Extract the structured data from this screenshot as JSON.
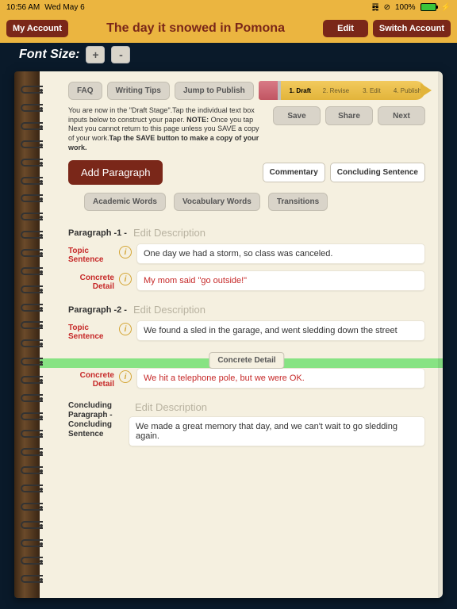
{
  "status": {
    "time": "10:56 AM",
    "date": "Wed May 6",
    "battery": "100%"
  },
  "header": {
    "my_account": "My Account",
    "title": "The day it snowed in Pomona",
    "edit": "Edit",
    "switch": "Switch Account"
  },
  "font": {
    "label": "Font Size:",
    "plus": "+",
    "minus": "-"
  },
  "pills": {
    "faq": "FAQ",
    "tips": "Writing Tips",
    "jump": "Jump to Publish"
  },
  "stages": {
    "s1": "1. Draft",
    "s2": "2. Revise",
    "s3": "3. Edit",
    "s4": "4. Publish"
  },
  "help": {
    "text1": "You are now in the \"Draft Stage\".Tap the individual text box inputs below to construct your paper. ",
    "note": "NOTE:",
    "text2": " Once you tap Next you cannot return to this page unless you SAVE a copy of your work.",
    "bold": "Tap the SAVE button to make a copy of your work."
  },
  "actions": {
    "save": "Save",
    "share": "Share",
    "next": "Next"
  },
  "add": {
    "label": "Add Paragraph",
    "commentary": "Commentary",
    "concluding": "Concluding Sentence"
  },
  "vocab": {
    "academic": "Academic Words",
    "vocabulary": "Vocabulary Words",
    "transitions": "Transitions"
  },
  "labels": {
    "topic": "Topic Sentence",
    "concrete": "Concrete Detail",
    "edit_desc": "Edit Description",
    "float": "Concrete Detail"
  },
  "p1": {
    "title": "Paragraph -1  -",
    "topic": "One day we had a storm, so class was canceled.",
    "detail": "My mom said \"go outside!\""
  },
  "p2": {
    "title": "Paragraph -2  -",
    "topic": "We found a sled in the garage, and went sledding down the street",
    "detail": "We hit a telephone pole, but we were OK."
  },
  "concl": {
    "title": "Concluding Paragraph  - Concluding Sentence",
    "text": "We made a great memory that day, and we can't wait to go sledding again."
  }
}
